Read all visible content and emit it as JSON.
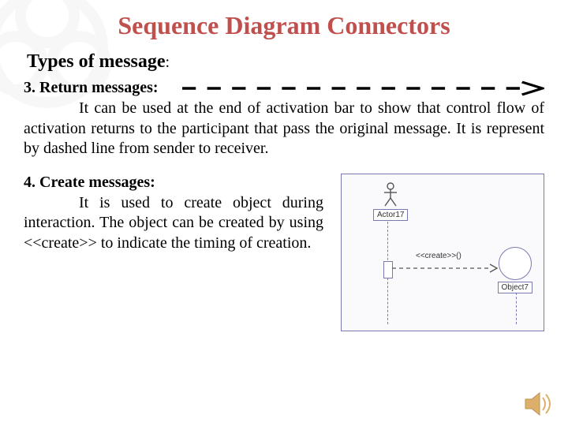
{
  "title": "Sequence Diagram Connectors",
  "subtitle": "Types of message",
  "section3": {
    "heading": "3. Return messages:",
    "body": "It can be used at the end of activation bar to show that control flow of activation returns to the participant that pass the original message. It is represent by dashed line from sender to receiver."
  },
  "section4": {
    "heading": "4. Create messages:",
    "body": "It is used to create object during interaction. The object can be created by using <<create>> to indicate the timing of creation."
  },
  "figure": {
    "actor_label": "Actor17",
    "object_label": "Object7",
    "message_label": "<<create>>()"
  }
}
